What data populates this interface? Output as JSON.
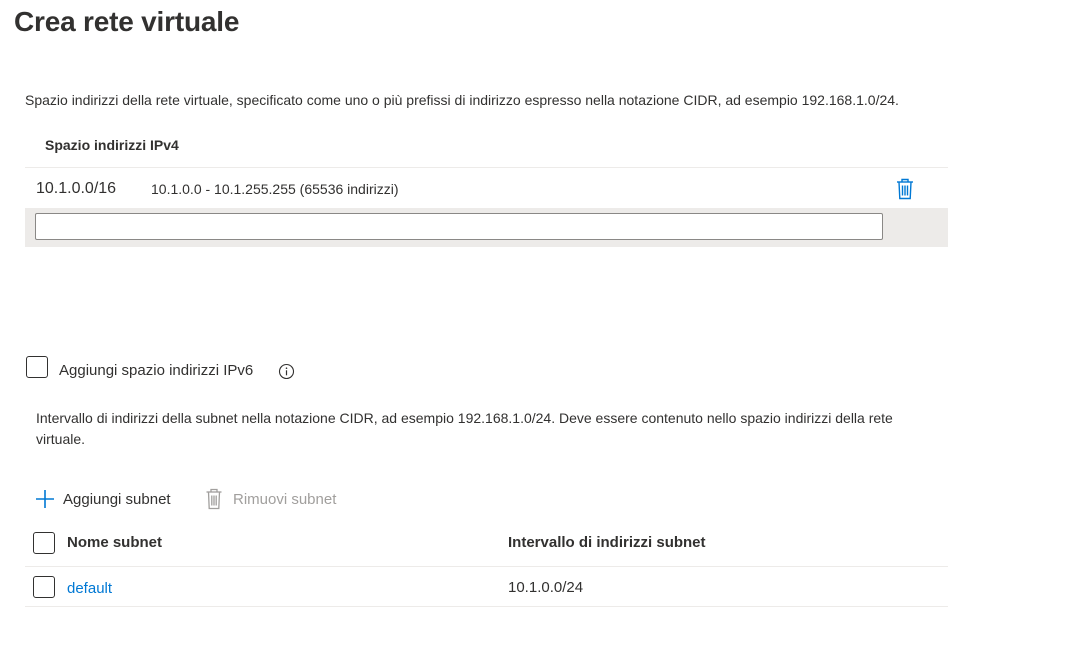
{
  "page": {
    "title": "Crea rete virtuale"
  },
  "address_space": {
    "description": "Spazio indirizzi della rete virtuale, specificato come uno o più prefissi di indirizzo espresso nella notazione CIDR, ad esempio 192.168.1.0/24.",
    "column_header": "Spazio indirizzi IPv4",
    "rows": [
      {
        "cidr": "10.1.0.0/16",
        "range": "10.1.0.0 - 10.1.255.255 (65536 indirizzi)"
      }
    ],
    "new_entry_value": "",
    "delete_icon": "trash-icon"
  },
  "ipv6": {
    "checked": false,
    "label": "Aggiungi spazio indirizzi IPv6",
    "info_icon": "info-icon"
  },
  "subnets": {
    "description": "Intervallo di indirizzi della subnet nella notazione CIDR, ad esempio 192.168.1.0/24. Deve essere contenuto nello spazio indirizzi della rete virtuale.",
    "toolbar": {
      "add_label": "Aggiungi subnet",
      "add_icon": "plus-icon",
      "remove_label": "Rimuovi subnet",
      "remove_icon": "trash-icon",
      "remove_disabled": true
    },
    "columns": [
      "Nome subnet",
      "Intervallo di indirizzi subnet"
    ],
    "rows": [
      {
        "name": "default",
        "range": "10.1.0.0/24"
      }
    ]
  },
  "colors": {
    "accent": "#0078d4",
    "text": "#323130",
    "disabled": "#a19f9d",
    "row_highlight": "#edebe9"
  }
}
